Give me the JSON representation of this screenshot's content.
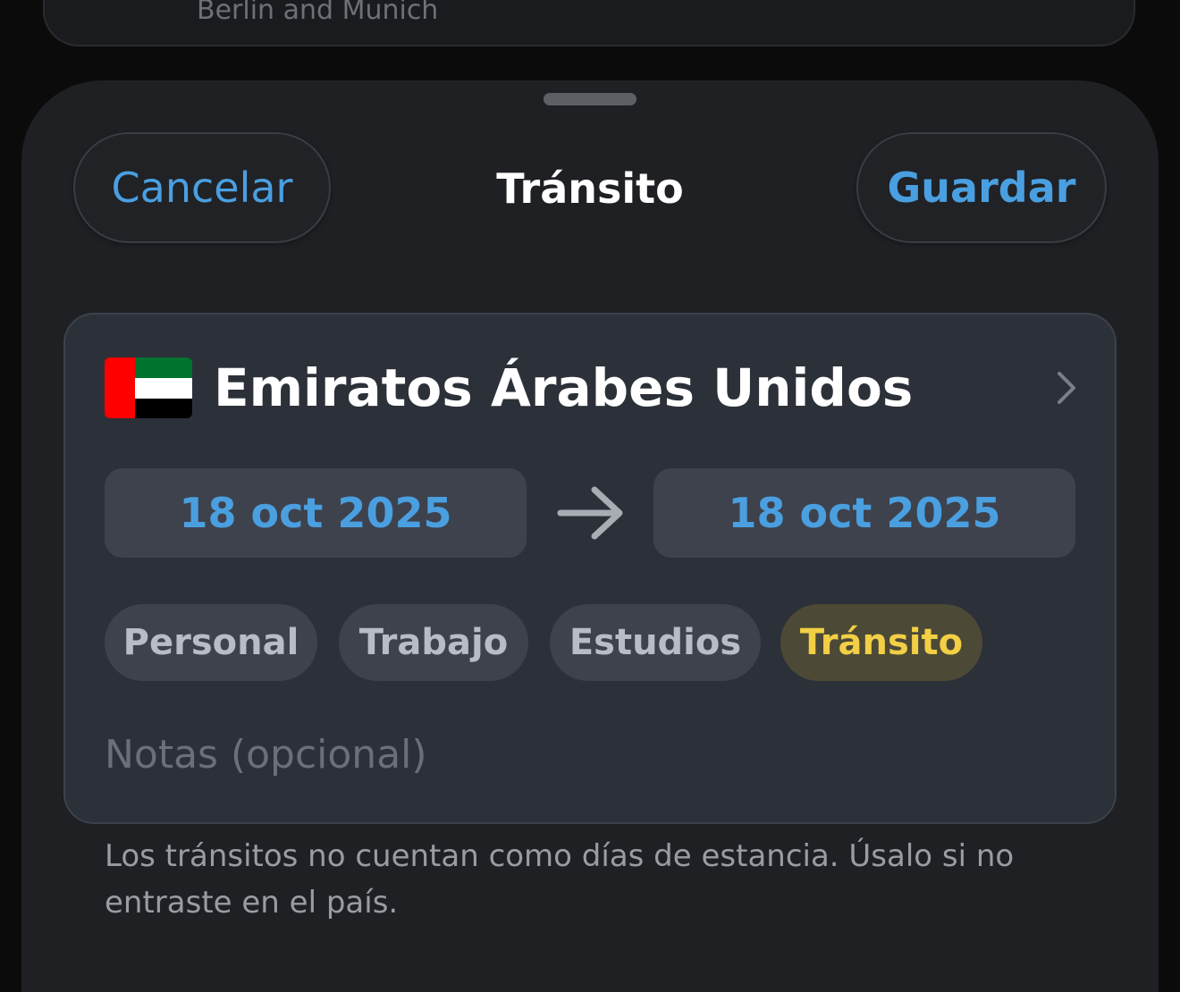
{
  "background_card": {
    "text": "Berlin and Munich"
  },
  "sheet": {
    "cancel_label": "Cancelar",
    "title": "Tránsito",
    "save_label": "Guardar"
  },
  "entry": {
    "country": {
      "name": "Emiratos Árabes Unidos",
      "flag_icon": "uae-flag-icon",
      "flag_colors": [
        "#ff0000",
        "#00732f",
        "#ffffff",
        "#000000"
      ]
    },
    "start_date": "18 oct 2025",
    "end_date": "18 oct 2025",
    "arrow_icon": "arrow-right-icon",
    "categories": [
      {
        "label": "Personal",
        "selected": false
      },
      {
        "label": "Trabajo",
        "selected": false
      },
      {
        "label": "Estudios",
        "selected": false
      },
      {
        "label": "Tránsito",
        "selected": true
      }
    ],
    "notes": {
      "placeholder": "Notas (opcional)",
      "value": ""
    }
  },
  "footnote": "Los tránsitos no cuentan como días de estancia. Úsalo si no entraste en el país.",
  "colors": {
    "accent": "#4a9fe0",
    "selected_chip_text": "#f2cf45",
    "selected_chip_bg": "#4c4a36",
    "sheet_bg": "#1f2024",
    "card_bg": "#2c3039"
  }
}
